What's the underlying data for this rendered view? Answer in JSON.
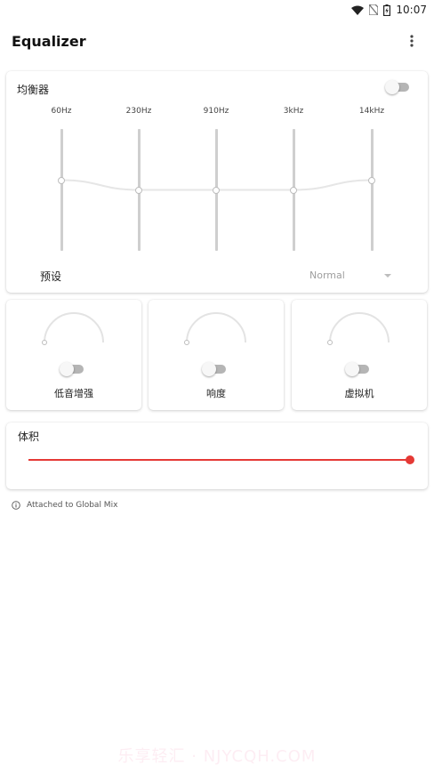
{
  "status_bar": {
    "time": "10:07",
    "icons": [
      "wifi-icon",
      "no-sim-icon",
      "battery-icon"
    ]
  },
  "appbar": {
    "title": "Equalizer",
    "menu_icon": "more-vert-icon"
  },
  "equalizer": {
    "label": "均衡器",
    "enabled": false,
    "bands": [
      {
        "freq": "60Hz",
        "level": 0.58
      },
      {
        "freq": "230Hz",
        "level": 0.5
      },
      {
        "freq": "910Hz",
        "level": 0.5
      },
      {
        "freq": "3kHz",
        "level": 0.5
      },
      {
        "freq": "14kHz",
        "level": 0.58
      }
    ],
    "preset_label": "预设",
    "preset_value": "Normal"
  },
  "effects": [
    {
      "label": "低音增强",
      "enabled": false,
      "level": 0
    },
    {
      "label": "响度",
      "enabled": false,
      "level": 0
    },
    {
      "label": "虚拟机",
      "enabled": false,
      "level": 0
    }
  ],
  "volume": {
    "label": "体积",
    "level": 1.0,
    "accent": "#e53935"
  },
  "footnote": {
    "text": "Attached to Global Mix",
    "icon": "info-icon"
  },
  "watermark": "乐享轻汇 · NJYCQH.COM"
}
